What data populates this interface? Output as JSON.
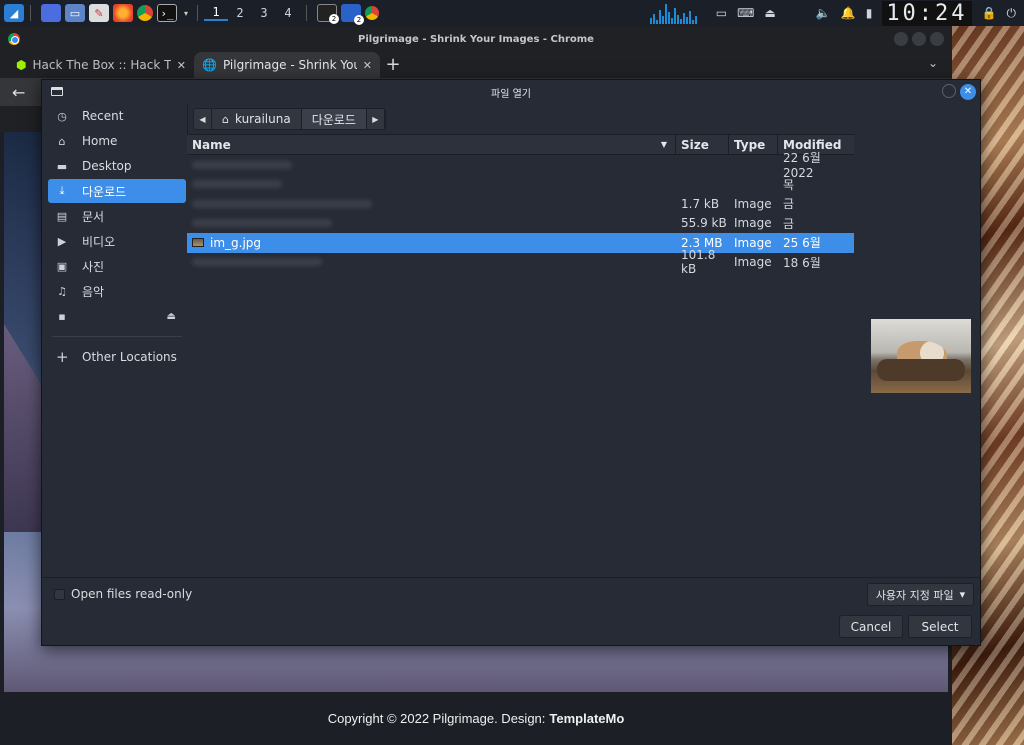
{
  "taskbar": {
    "workspaces": [
      "1",
      "2",
      "3",
      "4"
    ],
    "badge_1": "2",
    "badge_2": "2",
    "clock": "10:24"
  },
  "browser": {
    "window_title": "Pilgrimage - Shrink Your Images - Chrome",
    "tabs": [
      {
        "title": "Hack The Box :: Hack The Box"
      },
      {
        "title": "Pilgrimage - Shrink Your Images"
      }
    ],
    "new_tab": "+",
    "back": "←"
  },
  "page": {
    "footer_text": "Copyright © 2022 Pilgrimage. Design:",
    "footer_brand": "TemplateMo"
  },
  "dialog": {
    "title": "파일 열기",
    "sidebar": [
      {
        "label": "Recent",
        "icon": "clock-icon"
      },
      {
        "label": "Home",
        "icon": "home-icon"
      },
      {
        "label": "Desktop",
        "icon": "desktop-icon"
      },
      {
        "label": "다운로드",
        "icon": "download-icon"
      },
      {
        "label": "문서",
        "icon": "document-icon"
      },
      {
        "label": "비디오",
        "icon": "video-icon"
      },
      {
        "label": "사진",
        "icon": "image-icon"
      },
      {
        "label": "음악",
        "icon": "music-icon"
      },
      {
        "label": "",
        "icon": "drive-icon"
      },
      {
        "label": "Other Locations",
        "icon": "plus-icon"
      }
    ],
    "path": [
      "kurailuna",
      "다운로드"
    ],
    "columns": {
      "name": "Name",
      "size": "Size",
      "type": "Type",
      "modified": "Modified"
    },
    "files": [
      {
        "name": "",
        "size": "",
        "type": "",
        "modified": "22 6월 2022"
      },
      {
        "name": "",
        "size": "",
        "type": "",
        "modified": "목"
      },
      {
        "name": "",
        "size": "1.7 kB",
        "type": "Image",
        "modified": "금"
      },
      {
        "name": "",
        "size": "55.9 kB",
        "type": "Image",
        "modified": "금"
      },
      {
        "name": "im_g.jpg",
        "size": "2.3 MB",
        "type": "Image",
        "modified": "25 6월"
      },
      {
        "name": "",
        "size": "101.8 kB",
        "type": "Image",
        "modified": "18 6월"
      }
    ],
    "readonly_label": "Open files read-only",
    "filter_label": "사용자 지정 파일",
    "cancel_label": "Cancel",
    "select_label": "Select"
  },
  "colors": {
    "accent": "#3d8ee8",
    "dialog_bg": "#272b35"
  }
}
